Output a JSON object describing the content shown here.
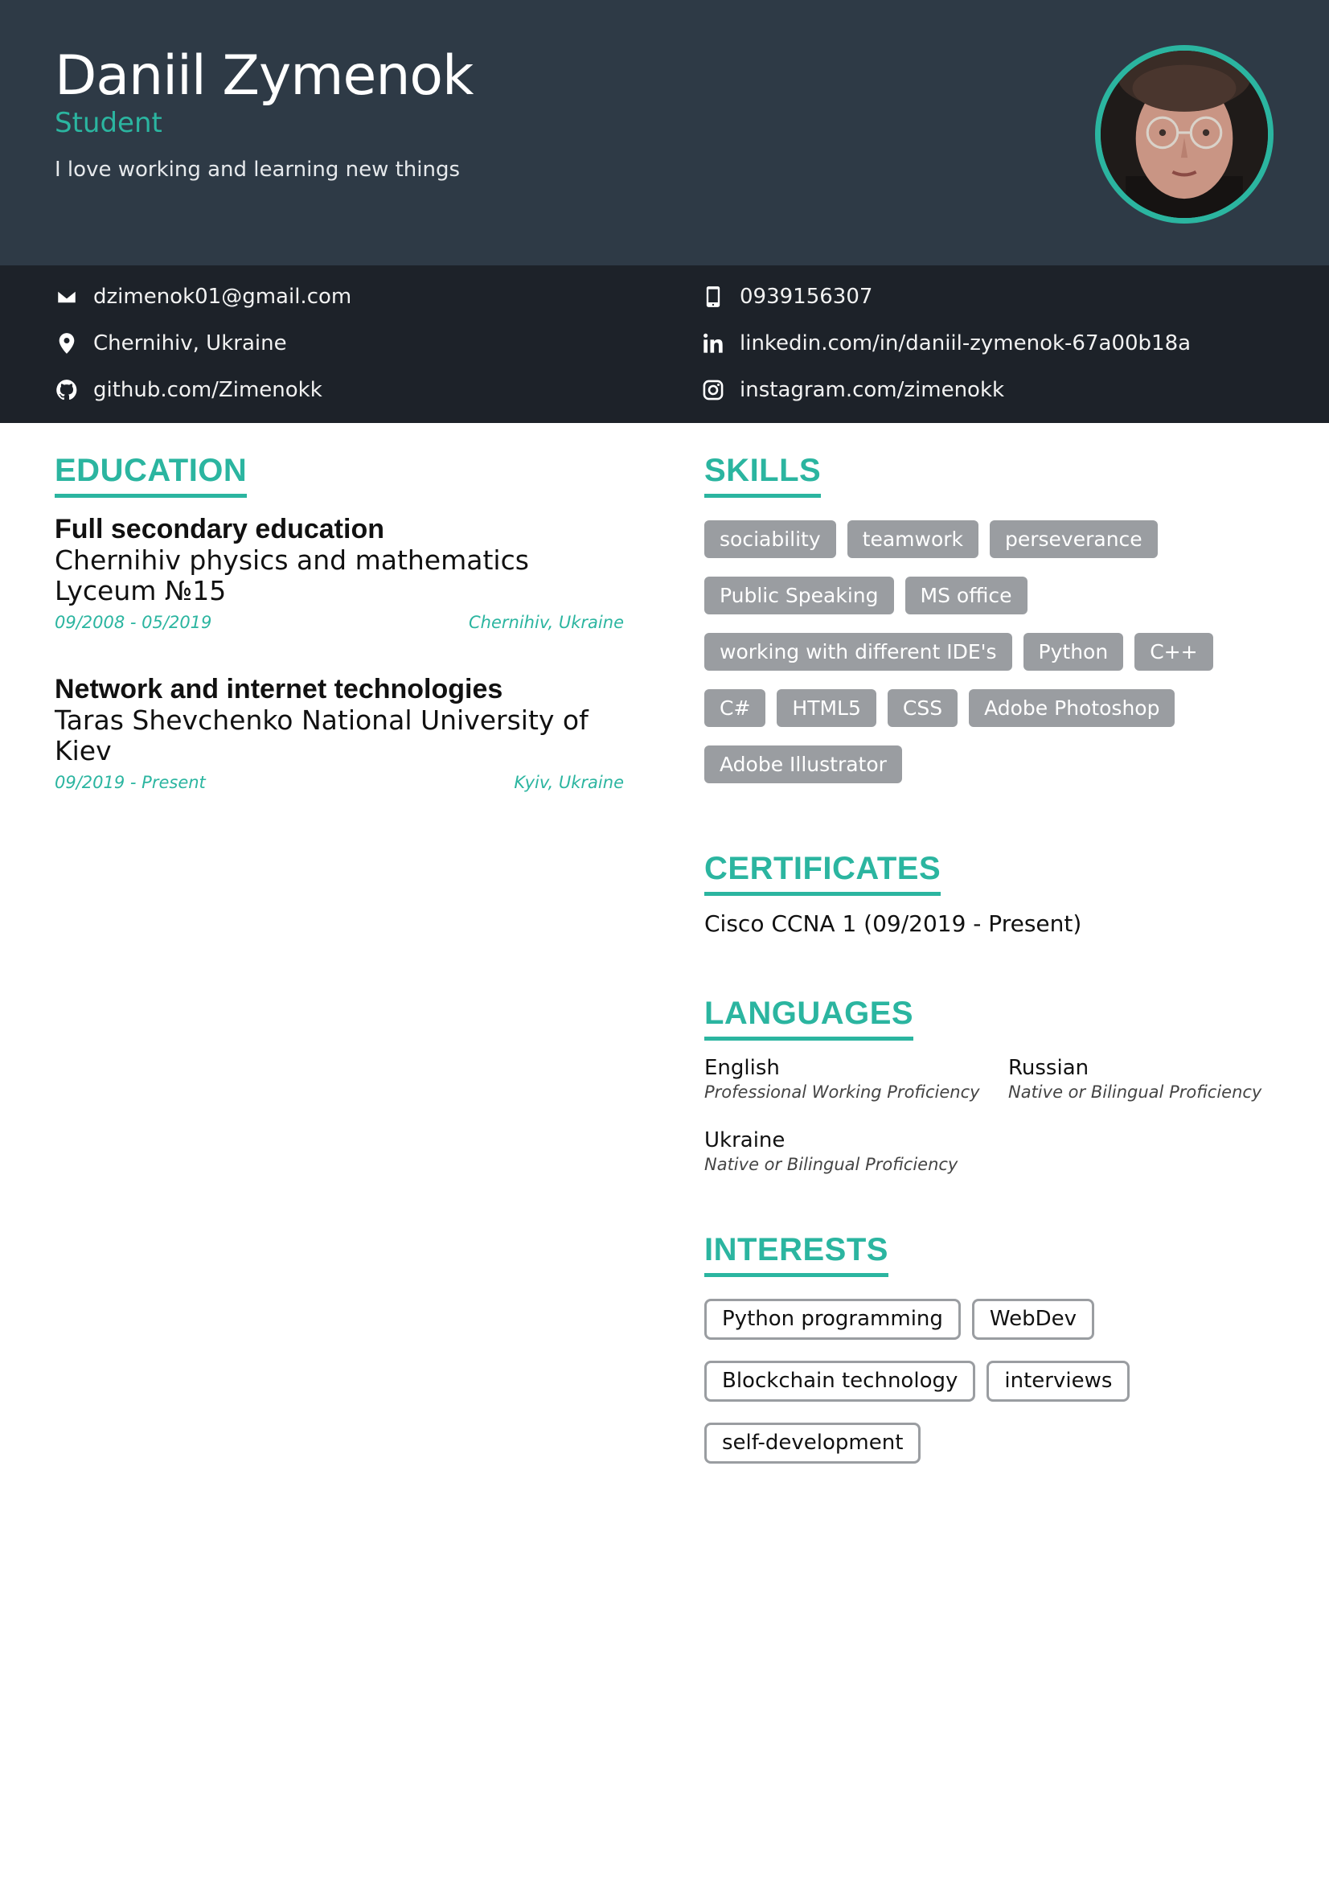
{
  "header": {
    "name": "Daniil Zymenok",
    "title": "Student",
    "tagline": "I love working and learning new things"
  },
  "contact": {
    "email": "dzimenok01@gmail.com",
    "location": "Chernihiv, Ukraine",
    "github": "github.com/Zimenokk",
    "phone": "0939156307",
    "linkedin": "linkedin.com/in/daniil-zymenok-67a00b18a",
    "instagram": "instagram.com/zimenokk",
    "icons": [
      "envelope-icon",
      "location-pin-icon",
      "github-icon",
      "phone-icon",
      "linkedin-icon",
      "instagram-icon"
    ]
  },
  "education": {
    "heading": "EDUCATION",
    "items": [
      {
        "degree": "Full secondary education",
        "school": "Chernihiv physics and mathematics Lyceum №15",
        "dates": "09/2008 - 05/2019",
        "location": "Chernihiv, Ukraine"
      },
      {
        "degree": "Network and internet technologies",
        "school": "Taras Shevchenko National University of Kiev",
        "dates": "09/2019 - Present",
        "location": "Kyiv, Ukraine"
      }
    ]
  },
  "skills": {
    "heading": "SKILLS",
    "items": [
      "sociability",
      "teamwork",
      "perseverance",
      "Public Speaking",
      "MS office",
      "working with different IDE's",
      "Python",
      "C++",
      "C#",
      "HTML5",
      "CSS",
      "Adobe Photoshop",
      "Adobe Illustrator"
    ]
  },
  "certificates": {
    "heading": "CERTIFICATES",
    "items": [
      "Cisco CCNA 1 (09/2019 - Present)"
    ]
  },
  "languages": {
    "heading": "LANGUAGES",
    "items": [
      {
        "name": "English",
        "level": "Professional Working Proficiency"
      },
      {
        "name": "Russian",
        "level": "Native or Bilingual Proficiency"
      },
      {
        "name": "Ukraine",
        "level": "Native or Bilingual Proficiency"
      }
    ]
  },
  "interests": {
    "heading": "INTERESTS",
    "items": [
      "Python programming",
      "WebDev",
      "Blockchain technology",
      "interviews",
      "self-development"
    ]
  },
  "colors": {
    "accent": "#2bb5a0",
    "header_bg": "#2e3a46",
    "contact_bg": "#1d2229",
    "chip_bg": "#9a9da1"
  }
}
